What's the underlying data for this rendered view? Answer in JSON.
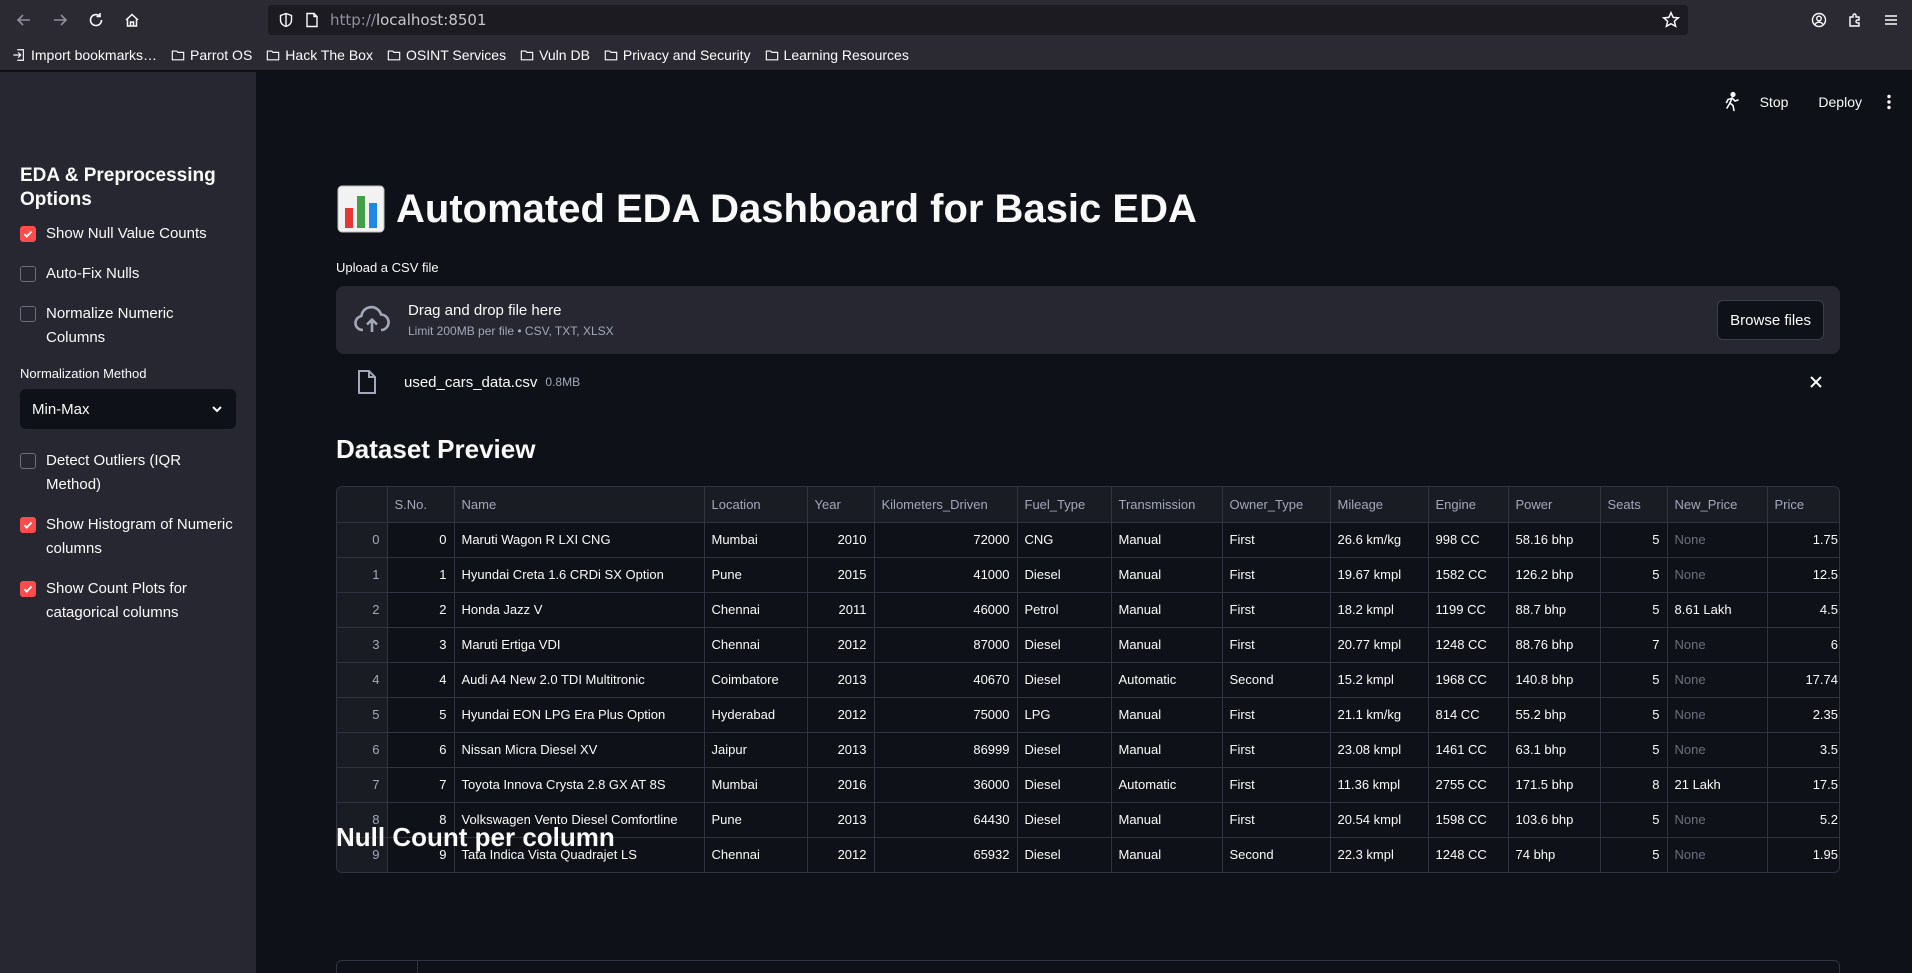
{
  "browser": {
    "url_prefix": "http://",
    "url_host": "localhost:8501",
    "bookmarks": [
      {
        "label": "Import bookmarks…",
        "icon": "import-icon"
      },
      {
        "label": "Parrot OS",
        "icon": "folder-icon"
      },
      {
        "label": "Hack The Box",
        "icon": "folder-icon"
      },
      {
        "label": "OSINT Services",
        "icon": "folder-icon"
      },
      {
        "label": "Vuln DB",
        "icon": "folder-icon"
      },
      {
        "label": "Privacy and Security",
        "icon": "folder-icon"
      },
      {
        "label": "Learning Resources",
        "icon": "folder-icon"
      }
    ]
  },
  "header": {
    "stop_label": "Stop",
    "deploy_label": "Deploy"
  },
  "sidebar": {
    "title": "EDA & Preprocessing Options",
    "checkbox_null_counts": {
      "label": "Show Null Value Counts",
      "checked": true
    },
    "checkbox_autofix": {
      "label": "Auto-Fix Nulls",
      "checked": false
    },
    "checkbox_normalize": {
      "label": "Normalize Numeric Columns",
      "checked": false
    },
    "normalization_label": "Normalization Method",
    "normalization_value": "Min-Max",
    "checkbox_outliers": {
      "label": "Detect Outliers (IQR Method)",
      "checked": false
    },
    "checkbox_histogram": {
      "label": "Show Histogram of Numeric columns",
      "checked": true
    },
    "checkbox_countplots": {
      "label": "Show Count Plots for catagorical columns",
      "checked": true
    },
    "accent_color": "#ff4b4b"
  },
  "main": {
    "title": "Automated EDA Dashboard for Basic EDA",
    "upload_label": "Upload a CSV file",
    "dropzone_main": "Drag and drop file here",
    "dropzone_sub": "Limit 200MB per file • CSV, TXT, XLSX",
    "browse_label": "Browse files",
    "file_name": "used_cars_data.csv",
    "file_size": "0.8MB",
    "preview_heading": "Dataset Preview",
    "null_heading": "Null Count per column"
  },
  "table": {
    "columns": [
      "",
      "S.No.",
      "Name",
      "Location",
      "Year",
      "Kilometers_Driven",
      "Fuel_Type",
      "Transmission",
      "Owner_Type",
      "Mileage",
      "Engine",
      "Power",
      "Seats",
      "New_Price",
      "Price"
    ],
    "rows": [
      [
        "0",
        "0",
        "Maruti Wagon R LXI CNG",
        "Mumbai",
        "2010",
        "72000",
        "CNG",
        "Manual",
        "First",
        "26.6 km/kg",
        "998 CC",
        "58.16 bhp",
        "5",
        "None",
        "1.75"
      ],
      [
        "1",
        "1",
        "Hyundai Creta 1.6 CRDi SX Option",
        "Pune",
        "2015",
        "41000",
        "Diesel",
        "Manual",
        "First",
        "19.67 kmpl",
        "1582 CC",
        "126.2 bhp",
        "5",
        "None",
        "12.5"
      ],
      [
        "2",
        "2",
        "Honda Jazz V",
        "Chennai",
        "2011",
        "46000",
        "Petrol",
        "Manual",
        "First",
        "18.2 kmpl",
        "1199 CC",
        "88.7 bhp",
        "5",
        "8.61 Lakh",
        "4.5"
      ],
      [
        "3",
        "3",
        "Maruti Ertiga VDI",
        "Chennai",
        "2012",
        "87000",
        "Diesel",
        "Manual",
        "First",
        "20.77 kmpl",
        "1248 CC",
        "88.76 bhp",
        "7",
        "None",
        "6"
      ],
      [
        "4",
        "4",
        "Audi A4 New 2.0 TDI Multitronic",
        "Coimbatore",
        "2013",
        "40670",
        "Diesel",
        "Automatic",
        "Second",
        "15.2 kmpl",
        "1968 CC",
        "140.8 bhp",
        "5",
        "None",
        "17.74"
      ],
      [
        "5",
        "5",
        "Hyundai EON LPG Era Plus Option",
        "Hyderabad",
        "2012",
        "75000",
        "LPG",
        "Manual",
        "First",
        "21.1 km/kg",
        "814 CC",
        "55.2 bhp",
        "5",
        "None",
        "2.35"
      ],
      [
        "6",
        "6",
        "Nissan Micra Diesel XV",
        "Jaipur",
        "2013",
        "86999",
        "Diesel",
        "Manual",
        "First",
        "23.08 kmpl",
        "1461 CC",
        "63.1 bhp",
        "5",
        "None",
        "3.5"
      ],
      [
        "7",
        "7",
        "Toyota Innova Crysta 2.8 GX AT 8S",
        "Mumbai",
        "2016",
        "36000",
        "Diesel",
        "Automatic",
        "First",
        "11.36 kmpl",
        "2755 CC",
        "171.5 bhp",
        "8",
        "21 Lakh",
        "17.5"
      ],
      [
        "8",
        "8",
        "Volkswagen Vento Diesel Comfortline",
        "Pune",
        "2013",
        "64430",
        "Diesel",
        "Manual",
        "First",
        "20.54 kmpl",
        "1598 CC",
        "103.6 bhp",
        "5",
        "None",
        "5.2"
      ],
      [
        "9",
        "9",
        "Tata Indica Vista Quadrajet LS",
        "Chennai",
        "2012",
        "65932",
        "Diesel",
        "Manual",
        "Second",
        "22.3 kmpl",
        "1248 CC",
        "74 bhp",
        "5",
        "None",
        "1.95"
      ]
    ]
  }
}
